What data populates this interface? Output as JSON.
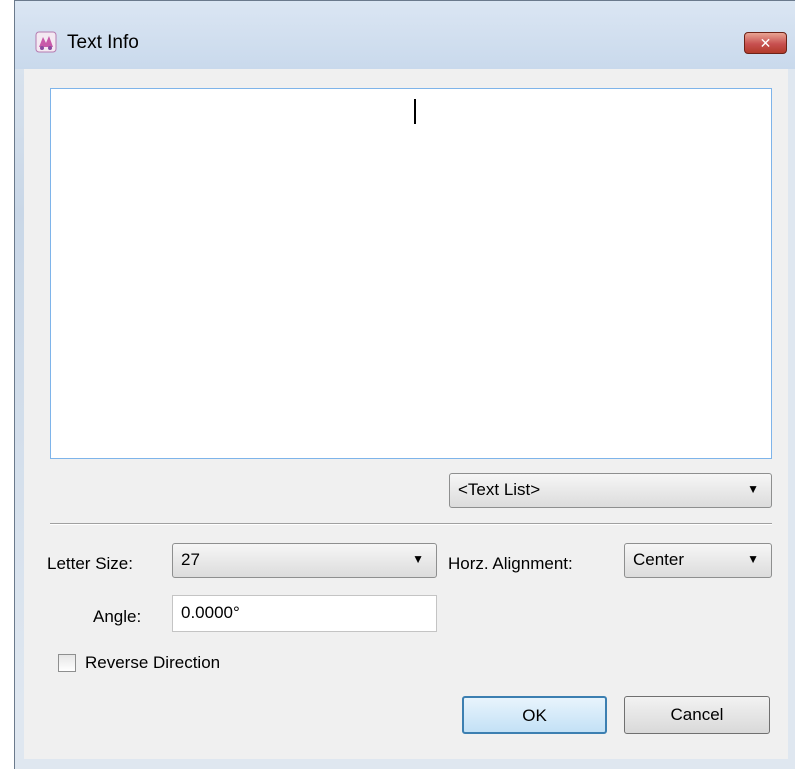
{
  "window": {
    "title": "Text Info",
    "close_label": "✕"
  },
  "text_list": {
    "selected": "<Text List>"
  },
  "letter_size": {
    "label": "Letter Size:",
    "value": "27"
  },
  "horz_alignment": {
    "label": "Horz. Alignment:",
    "value": "Center"
  },
  "angle": {
    "label": "Angle:",
    "value": "0.0000°"
  },
  "reverse_direction": {
    "label": "Reverse Direction",
    "checked": false
  },
  "buttons": {
    "ok": "OK",
    "cancel": "Cancel"
  },
  "icons": {
    "app": "app-icon",
    "dropdown": "chevron-down-icon",
    "close": "close-icon"
  }
}
